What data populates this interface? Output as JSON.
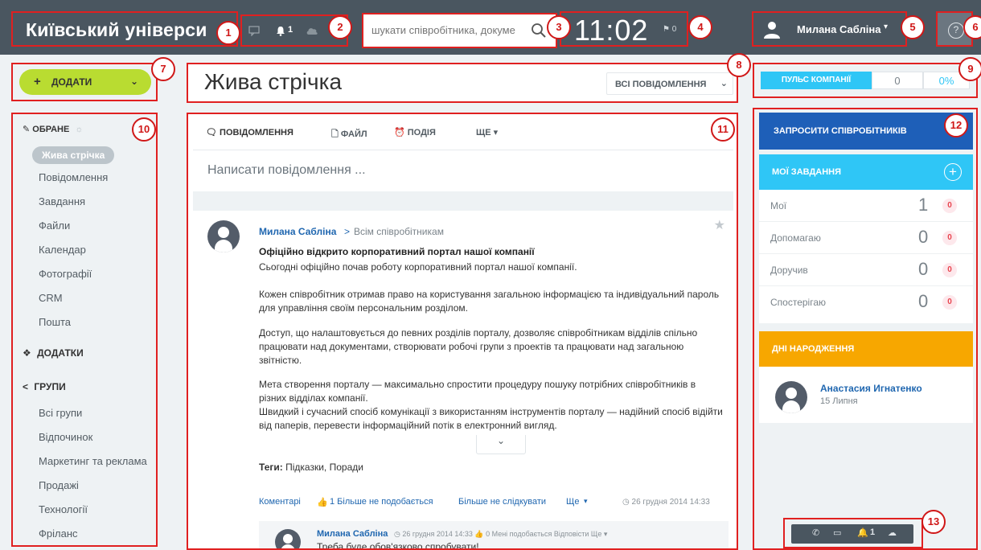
{
  "header": {
    "logo": "Київський універси",
    "notifications": {
      "count": "1"
    },
    "search": {
      "placeholder": "шукати співробітника, докуме"
    },
    "clock": "11:02",
    "flag_count": "0",
    "user": {
      "name": "Милана Сабліна"
    }
  },
  "callouts": [
    "1",
    "2",
    "3",
    "4",
    "5",
    "6",
    "7",
    "8",
    "9",
    "10",
    "11",
    "12",
    "13"
  ],
  "left": {
    "add_button": "ДОДАТИ",
    "favorites_head": "ОБРАНЕ",
    "active_item": "Жива стрічка",
    "items": [
      "Повідомлення",
      "Завдання",
      "Файли",
      "Календар",
      "Фотографії",
      "CRM",
      "Пошта"
    ],
    "apps_head": "ДОДАТКИ",
    "groups_head": "ГРУПИ",
    "groups": [
      "Всі групи",
      "Відпочинок",
      "Маркетинг та реклама",
      "Продажі",
      "Технології",
      "Фріланс"
    ]
  },
  "center": {
    "title": "Жива стрічка",
    "filter": "ВСІ ПОВІДОМЛЕННЯ",
    "tabs": [
      "ПОВІДОМЛЕННЯ",
      "ФАЙЛ",
      "ПОДІЯ",
      "ЩЕ"
    ],
    "compose_placeholder": "Написати повідомлення ...",
    "post": {
      "author": "Милана Сабліна",
      "arrow": ">",
      "target": "Всім співробітникам",
      "title": "Офіційно відкрито корпоративний портал нашої компанії",
      "p1": "Сьогодні офіційно почав роботу корпоративний портал нашої компанії.",
      "p2": "Кожен співробітник отримав право на користування загальною інформацією та індивідуальний пароль для управління своїм персональним розділом.",
      "p3": "Доступ, що налаштовується до певних розділів порталу, дозволяє співробітникам відділів спільно працювати над документами, створювати робочі групи з проектів та працювати над загальною звітністю.",
      "p4": "Мета створення порталу — максимально спростити процедуру пошуку потрібних співробітників в різних відділах компанії.",
      "p5": "Швидкий і сучасний спосіб комунікації з використанням інструментів порталу — надійний спосіб відійти від паперів, перевести інформаційний потік в електронний вигляд.",
      "tags_label": "Теги:",
      "tags": "Підказки, Поради",
      "actions": [
        "Коментарі",
        "1 Більше не подобається",
        "Більше не слідкувати",
        "Ще"
      ],
      "date": "26 грудня 2014 14:33"
    },
    "comment": {
      "author": "Милана Сабліна",
      "meta": "◷ 26 грудня 2014 14:33    👍 0 Мені подобається   Відповісти   Ще ▾",
      "text": "Треба буде обов'язково спробувати!"
    }
  },
  "right": {
    "pulse_label": "ПУЛЬС КОМПАНІЇ",
    "pulse_count": "0",
    "pulse_percent": "0%",
    "invite": "ЗАПРОСИТИ СПІВРОБІТНИКІВ",
    "tasks_head": "МОЇ ЗАВДАННЯ",
    "tasks": [
      {
        "label": "Мої",
        "count": "1",
        "badge": "0"
      },
      {
        "label": "Допомагаю",
        "count": "0",
        "badge": "0"
      },
      {
        "label": "Доручив",
        "count": "0",
        "badge": "0"
      },
      {
        "label": "Спостерігаю",
        "count": "0",
        "badge": "0"
      }
    ],
    "birthdays_head": "ДНІ НАРОДЖЕННЯ",
    "birthday": {
      "name": "Анастасия Игнатенко",
      "date": "15 Липня"
    },
    "bottom_bar": {
      "notifications": "1"
    }
  }
}
